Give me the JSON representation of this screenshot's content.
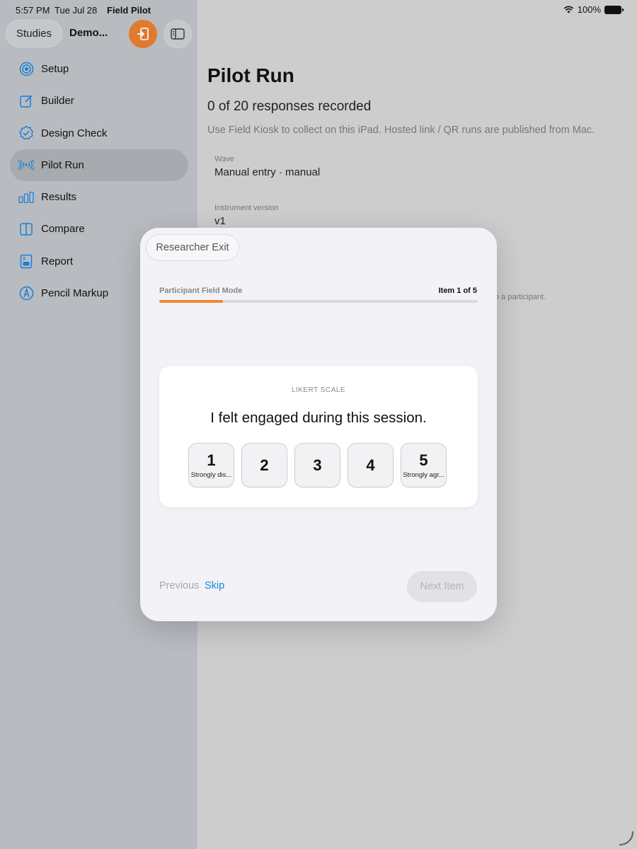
{
  "status_bar": {
    "time": "5:57 PM",
    "date": "Tue Jul 28",
    "app_name": "Field Pilot",
    "battery": "100%",
    "wifi_icon": "wifi-icon",
    "battery_icon": "battery-icon"
  },
  "sidebar": {
    "studies_button": "Studies",
    "study_title": "Demo...",
    "accent_color": "#e07a2e",
    "items": [
      {
        "label": "Setup",
        "icon": "target-icon",
        "active": false
      },
      {
        "label": "Builder",
        "icon": "edit-square-icon",
        "active": false
      },
      {
        "label": "Design Check",
        "icon": "checkmark-seal-icon",
        "active": false
      },
      {
        "label": "Pilot Run",
        "icon": "broadcast-icon",
        "active": true
      },
      {
        "label": "Results",
        "icon": "bar-chart-icon",
        "active": false
      },
      {
        "label": "Compare",
        "icon": "split-view-icon",
        "active": false
      },
      {
        "label": "Report",
        "icon": "report-icon",
        "active": false
      },
      {
        "label": "Pencil Markup",
        "icon": "pencil-tip-icon",
        "active": false
      }
    ]
  },
  "main": {
    "title": "Pilot Run",
    "subtitle": "0 of 20 responses recorded",
    "note": "Use Field Kiosk to collect on this iPad. Hosted link / QR runs are published from Mac.",
    "fields": [
      {
        "label": "Wave",
        "value": "Manual entry · manual"
      },
      {
        "label": "Instrument version",
        "value": "v1"
      }
    ],
    "obscured_fragment": "o a participant."
  },
  "modal": {
    "exit_button": "Researcher Exit",
    "mode_label": "Participant Field Mode",
    "item_counter": "Item 1 of 5",
    "progress": 0.2,
    "progress_color": "#f0892e",
    "question": {
      "type_label": "LIKERT SCALE",
      "text": "I felt engaged during this session.",
      "options": [
        {
          "value": "1",
          "label": "Strongly dis..."
        },
        {
          "value": "2",
          "label": ""
        },
        {
          "value": "3",
          "label": ""
        },
        {
          "value": "4",
          "label": ""
        },
        {
          "value": "5",
          "label": "Strongly agr..."
        }
      ]
    },
    "previous_button": "Previous",
    "skip_button": "Skip",
    "skip_color": "#1a86d9",
    "next_button": "Next Item"
  }
}
